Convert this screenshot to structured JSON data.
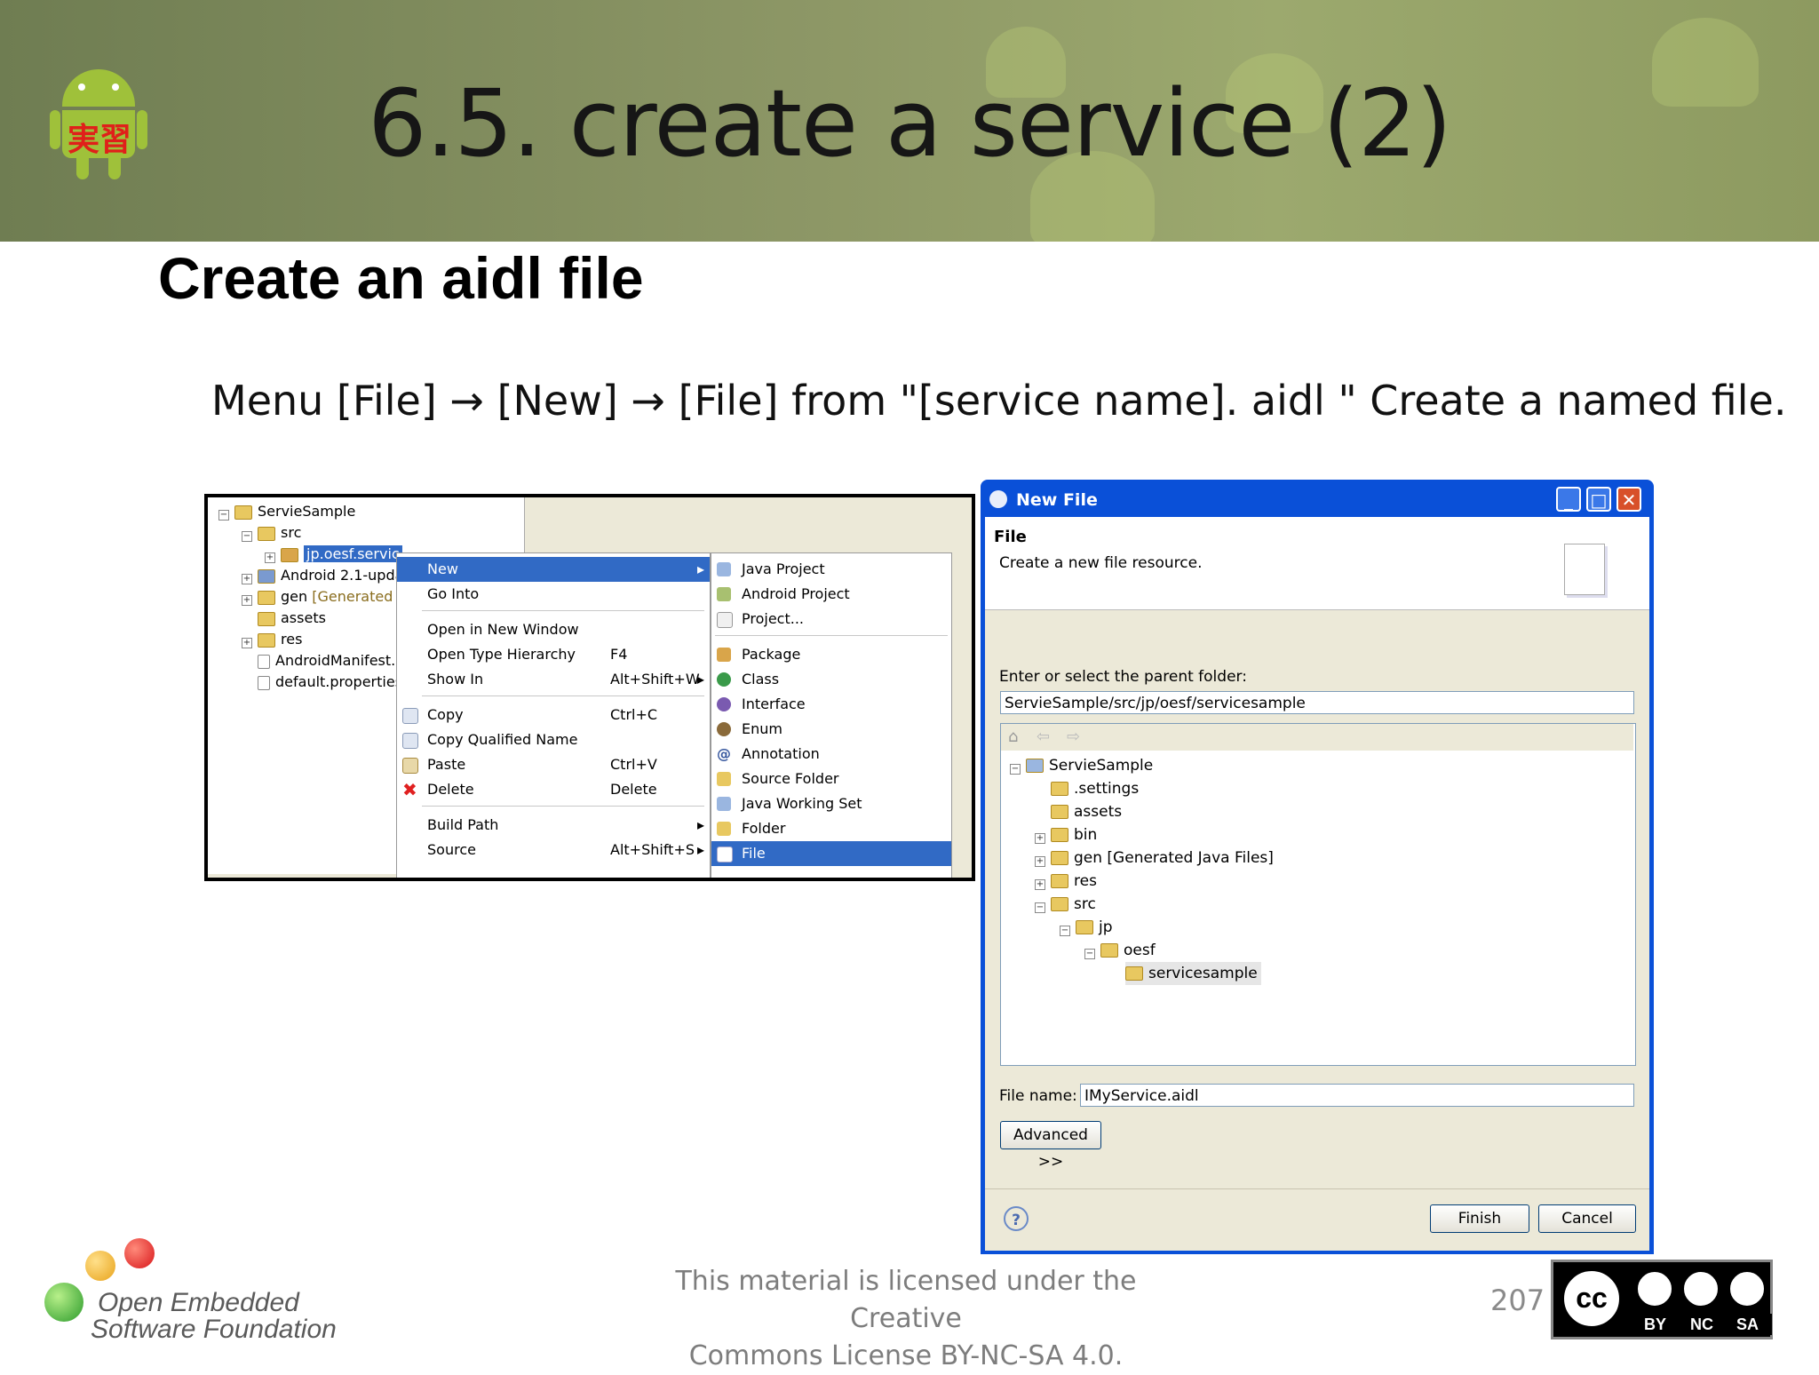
{
  "slide": {
    "title": "6.5. create a service (2)",
    "subtitle": "Create an aidl file",
    "instruction": "Menu [File] → [New] → [File] from \"[service name]. aidl \" Create a named file.",
    "badge_text": "実習",
    "footer_line1": "This material is licensed under the Creative",
    "footer_line2": "Commons License BY-NC-SA 4.0.",
    "page_number": "207",
    "logo_line1": "Open Embedded",
    "logo_line2": "Software Foundation",
    "cc_main": "cc",
    "cc_by": "BY",
    "cc_nc": "NC",
    "cc_sa": "SA"
  },
  "explorer": {
    "items": [
      {
        "label": "ServieSample"
      },
      {
        "label": "src"
      },
      {
        "label": "jp.oesf.servic"
      },
      {
        "label": "Android 2.1-upda"
      },
      {
        "label": "gen",
        "extra": "[Generated"
      },
      {
        "label": "assets"
      },
      {
        "label": "res"
      },
      {
        "label": "AndroidManifest."
      },
      {
        "label": "default.properties"
      }
    ]
  },
  "context_menu": {
    "items": [
      {
        "label": "New",
        "shortcut": ""
      },
      {
        "label": "Go Into",
        "shortcut": ""
      },
      {
        "label": "Open in New Window",
        "shortcut": ""
      },
      {
        "label": "Open Type Hierarchy",
        "shortcut": "F4"
      },
      {
        "label": "Show In",
        "shortcut": "Alt+Shift+W"
      },
      {
        "label": "Copy",
        "shortcut": "Ctrl+C"
      },
      {
        "label": "Copy Qualified Name",
        "shortcut": ""
      },
      {
        "label": "Paste",
        "shortcut": "Ctrl+V"
      },
      {
        "label": "Delete",
        "shortcut": "Delete"
      },
      {
        "label": "Build Path",
        "shortcut": ""
      },
      {
        "label": "Source",
        "shortcut": "Alt+Shift+S"
      }
    ]
  },
  "new_submenu": {
    "items": [
      {
        "label": "Java Project"
      },
      {
        "label": "Android Project"
      },
      {
        "label": "Project..."
      },
      {
        "label": "Package"
      },
      {
        "label": "Class"
      },
      {
        "label": "Interface"
      },
      {
        "label": "Enum"
      },
      {
        "label": "Annotation"
      },
      {
        "label": "Source Folder"
      },
      {
        "label": "Java Working Set"
      },
      {
        "label": "Folder"
      },
      {
        "label": "File"
      }
    ]
  },
  "dialog": {
    "window_title": "New File",
    "heading": "File",
    "description": "Create a new file resource.",
    "parent_label": "Enter or select the parent folder:",
    "parent_value": "ServieSample/src/jp/oesf/servicesample",
    "tree": [
      {
        "label": "ServieSample"
      },
      {
        "label": ".settings"
      },
      {
        "label": "assets"
      },
      {
        "label": "bin"
      },
      {
        "label": "gen [Generated Java Files]"
      },
      {
        "label": "res"
      },
      {
        "label": "src"
      },
      {
        "label": "jp"
      },
      {
        "label": "oesf"
      },
      {
        "label": "servicesample"
      }
    ],
    "filename_label": "File name:",
    "filename_value": "IMyService.aidl",
    "advanced_button": "Advanced >>",
    "finish_button": "Finish",
    "cancel_button": "Cancel",
    "help_icon": "?"
  }
}
